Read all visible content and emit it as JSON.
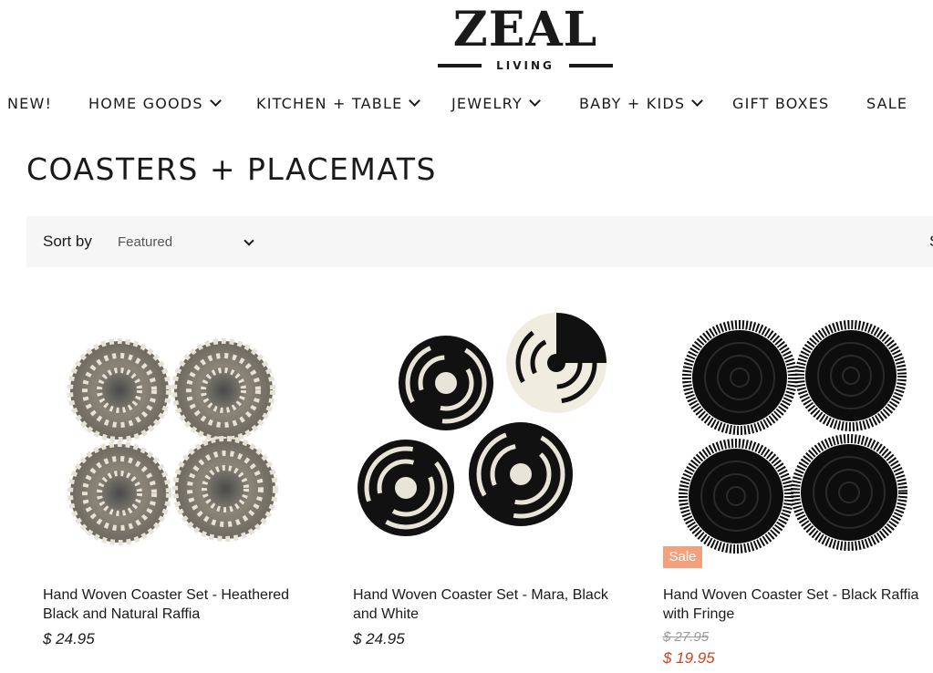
{
  "brand": {
    "name": "ZEAL",
    "tagline": "LIVING"
  },
  "nav": [
    {
      "label": "NEW!",
      "has_dropdown": false
    },
    {
      "label": "HOME GOODS",
      "has_dropdown": true
    },
    {
      "label": "KITCHEN + TABLE",
      "has_dropdown": true
    },
    {
      "label": "JEWELRY",
      "has_dropdown": true
    },
    {
      "label": "BABY + KIDS",
      "has_dropdown": true
    },
    {
      "label": "GIFT BOXES",
      "has_dropdown": false
    },
    {
      "label": "SALE",
      "has_dropdown": false
    }
  ],
  "page": {
    "title": "COASTERS + PLACEMATS"
  },
  "sort": {
    "label": "Sort by",
    "selected": "Featured",
    "clipped_text": "S"
  },
  "products": [
    {
      "title": "Hand Woven Coaster Set - Heathered Black and Natural Raffia",
      "price": "$ 24.95",
      "icon": "heathered-coaster-set-image"
    },
    {
      "title": "Hand Woven Coaster Set - Mara, Black and White",
      "price": "$ 24.95",
      "icon": "mara-coaster-set-image"
    },
    {
      "title": "Hand Woven Coaster Set - Black Raffia with Fringe",
      "badge": "Sale",
      "price_original": "$ 27.95",
      "price_sale": "$ 19.95",
      "icon": "fringe-coaster-set-image"
    }
  ],
  "colors": {
    "sale_badge": "#f3a07d",
    "sale_price": "#d0421f",
    "sort_bar_bg": "#f6f6f6",
    "text": "#1a1a1a"
  }
}
